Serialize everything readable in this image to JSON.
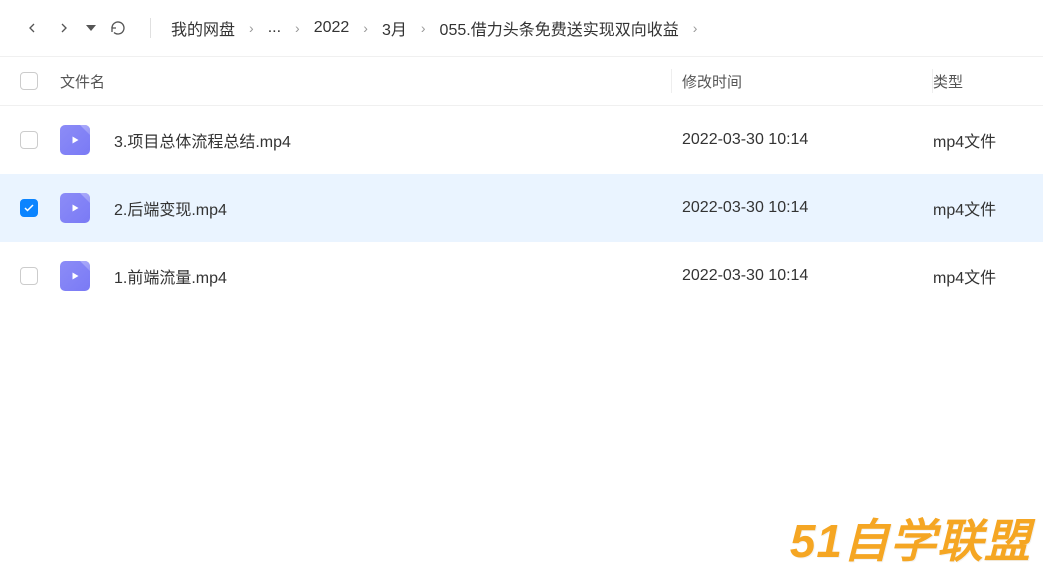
{
  "breadcrumb": {
    "root": "我的网盘",
    "ellipsis": "...",
    "year": "2022",
    "month": "3月",
    "folder": "055.借力头条免费送实现双向收益"
  },
  "columns": {
    "name": "文件名",
    "date": "修改时间",
    "type": "类型"
  },
  "files": [
    {
      "name": "3.项目总体流程总结.mp4",
      "date": "2022-03-30 10:14",
      "type": "mp4文件",
      "checked": false
    },
    {
      "name": "2.后端变现.mp4",
      "date": "2022-03-30 10:14",
      "type": "mp4文件",
      "checked": true
    },
    {
      "name": "1.前端流量.mp4",
      "date": "2022-03-30 10:14",
      "type": "mp4文件",
      "checked": false
    }
  ],
  "watermark": "51自学联盟"
}
